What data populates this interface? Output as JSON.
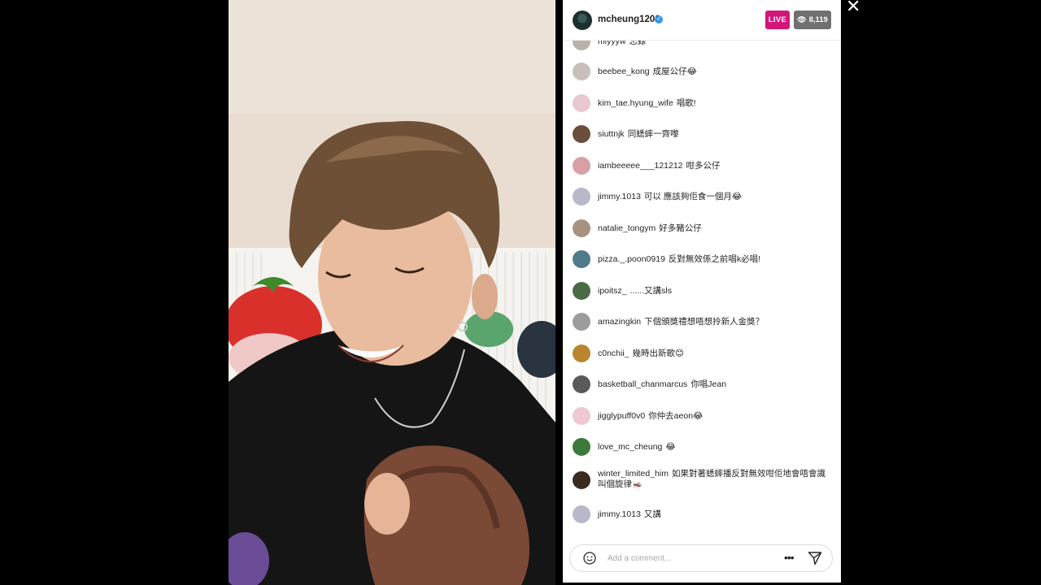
{
  "host": {
    "username": "mcheung1201",
    "verified_icon": "verified-badge-icon",
    "live_label": "LIVE",
    "viewer_count": "8,119"
  },
  "comments": [
    {
      "user": "miyyyw",
      "text": "忘錄",
      "avatar": "#b9b2aa"
    },
    {
      "user": "beebee_kong",
      "text": "成屋公仔😂",
      "avatar": "#c8bfbb"
    },
    {
      "user": "kim_tae.hyung_wife",
      "text": "唱歌!",
      "avatar": "#e9c8cf"
    },
    {
      "user": "siuttnjk",
      "text": "同蟋蟀一齊嚟",
      "avatar": "#6b4d3b"
    },
    {
      "user": "iambeeeee___121212",
      "text": "咁多公仔",
      "avatar": "#d8a0a6"
    },
    {
      "user": "jimmy.1013",
      "text": "可以 應該夠佢食一個月😂",
      "avatar": "#b8b8c8"
    },
    {
      "user": "natalie_tongym",
      "text": "好多豬公仔",
      "avatar": "#a79180"
    },
    {
      "user": "pizza._.poon0919",
      "text": "反對無效係之前唱k必唱!",
      "avatar": "#4f7b8c"
    },
    {
      "user": "ipoitsz_",
      "text": "......又講sls",
      "avatar": "#4a6a46"
    },
    {
      "user": "amazingkin",
      "text": "下個頒獎禮想唔想拎新人金獎？",
      "avatar": "#9c9c9c"
    },
    {
      "user": "c0nchii_",
      "text": "幾時出新歌😊",
      "avatar": "#b9862f"
    },
    {
      "user": "basketball_chanmarcus",
      "text": "你唱Jean",
      "avatar": "#5a5a5a"
    },
    {
      "user": "jigglypuff0v0",
      "text": "你仲去aeon😂",
      "avatar": "#f0c8d2"
    },
    {
      "user": "love_mc_cheung",
      "text": "😂",
      "avatar": "#3c7a3a"
    },
    {
      "user": "winter_limited_him",
      "text": "如果對著蟋蟀播反對無效咁佢地會唔會識叫個旋律🦗",
      "avatar": "#3a2a20"
    },
    {
      "user": "jimmy.1013",
      "text": "又講",
      "avatar": "#b8b8c8"
    }
  ],
  "composer": {
    "placeholder": "Add a comment...",
    "more_label": "•••"
  },
  "close_label": "✕"
}
